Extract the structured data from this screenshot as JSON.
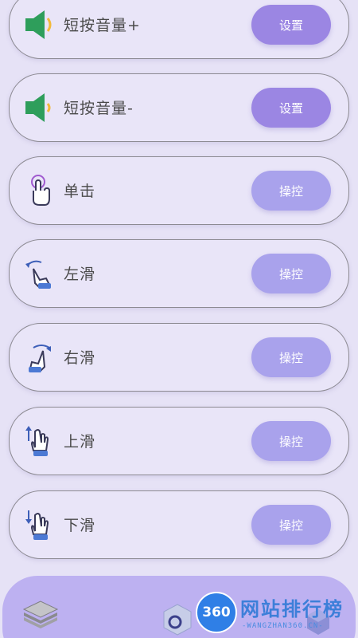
{
  "items": [
    {
      "label": "短按音量+",
      "button": "设置",
      "icon": "speaker-volume-up-icon",
      "style": "primary"
    },
    {
      "label": "短按音量-",
      "button": "设置",
      "icon": "speaker-volume-down-icon",
      "style": "primary"
    },
    {
      "label": "单击",
      "button": "操控",
      "icon": "hand-tap-icon",
      "style": "secondary"
    },
    {
      "label": "左滑",
      "button": "操控",
      "icon": "hand-swipe-left-icon",
      "style": "secondary"
    },
    {
      "label": "右滑",
      "button": "操控",
      "icon": "hand-swipe-right-icon",
      "style": "secondary"
    },
    {
      "label": "上滑",
      "button": "操控",
      "icon": "hand-swipe-up-icon",
      "style": "secondary"
    },
    {
      "label": "下滑",
      "button": "操控",
      "icon": "hand-swipe-down-icon",
      "style": "secondary"
    }
  ],
  "watermark": {
    "badge": "360",
    "title": "网站排行榜",
    "subtitle": "-WANGZHAN360.CN-"
  },
  "colors": {
    "background": "#e6e2f6",
    "primary_button": "#9b86e3",
    "secondary_button": "#a9a2ec",
    "bottom_bar": "#bdb1f1",
    "speaker_green": "#2e9e5b"
  }
}
